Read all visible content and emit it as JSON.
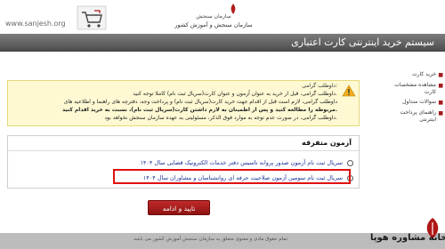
{
  "watermark": "www.sanjesh.org",
  "header": {
    "org_line1": "سازمان سنجش",
    "org_line2": "سازمان سنجش و آموزش کشور"
  },
  "titlebar": {
    "title": "سیستم خرید اینترنتی کارت اعتباری"
  },
  "sidebar": {
    "items": [
      {
        "label": "خرید کارت"
      },
      {
        "label": "مشاهده مشخصات کارت"
      },
      {
        "label": "سوالات متداول"
      },
      {
        "label": "راهنمای پرداخت اینترنتی"
      }
    ]
  },
  "notice": {
    "title": "داوطلب گرامی:",
    "lines": [
      "داوطلب گرامی، قبل از خرید به عنوان آزمون و عنوان کارت(سریال ثبت نام) کاملا توجه کنید.",
      "داوطلب گرامی، لازم است قبل از اقدام جهت خرید کارت(سریال ثبت نام) و پرداخت وجه، دفترچه های راهنما و اطلاعیه های",
      "مربوطه را مطالعه کنید و پس از اطمینان به لازم داشتن کارت(سریال ثبت نام)، نسبت به خرید اقدام کنید.",
      "داوطلب گرامی، در صورت عدم توجه به موارد فوق الذکر، مسئولیتی به عهده سازمان سنجش نخواهد بود."
    ]
  },
  "exams": {
    "title": "آزمون متفرقه",
    "options": [
      {
        "label": "سریال ثبت نام آزمون صدور پروانه تاسیس دفتر خدمات الکترونیک قضایی سال ۱۴۰۴"
      },
      {
        "label": "سریال ثبت نام سومین آزمون صلاحیت حرفه ای روانشناسان و مشاوران سال ۱۴۰۴"
      }
    ]
  },
  "confirm_button": "تایید و ادامه",
  "footer": {
    "text": "تمام حقوق مادی و معنوی متعلق به سازمان سنجش آموزش کشور می باشد"
  },
  "badge": {
    "text": "خانه مشاوره هوپا"
  },
  "colors": {
    "accent": "#a81818",
    "link": "#1a2f9a",
    "highlight": "#e01010",
    "notice_bg": "#fef9d3"
  }
}
